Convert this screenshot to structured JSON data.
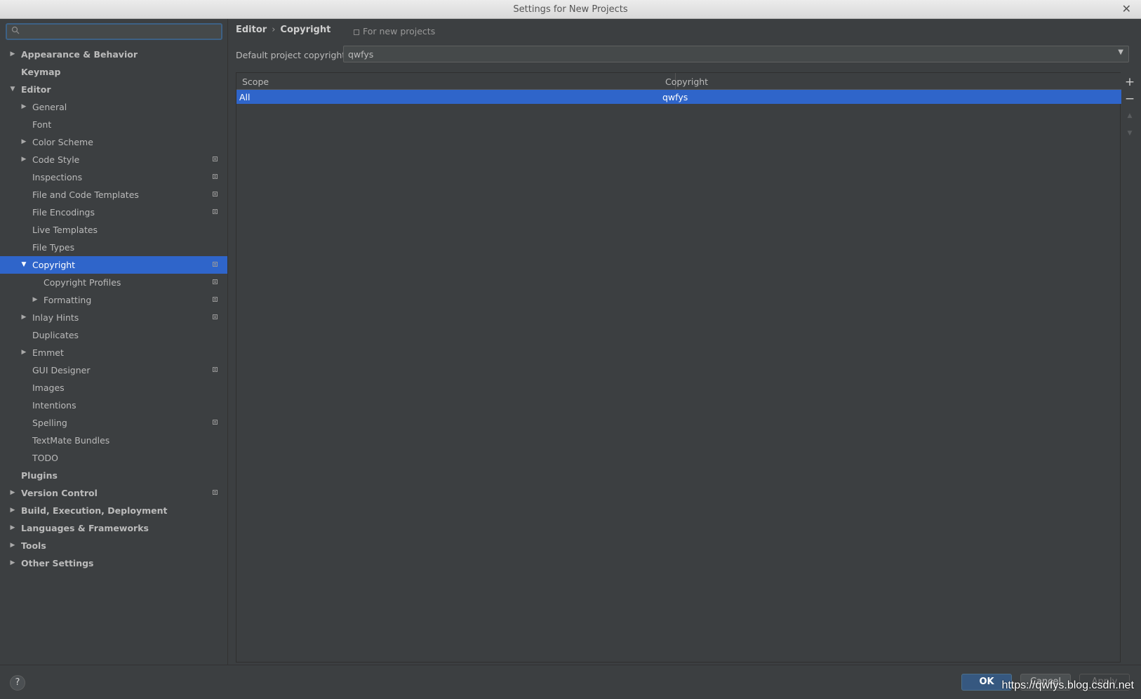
{
  "window": {
    "title": "Settings for New Projects",
    "close_glyph": "✕"
  },
  "sidebar": {
    "search": {
      "value": "",
      "placeholder": ""
    },
    "items": [
      {
        "label": "Appearance & Behavior",
        "level": 0,
        "expander": "collapsed",
        "bold": true,
        "project_icon": false,
        "selected": false
      },
      {
        "label": "Keymap",
        "level": 0,
        "expander": "none",
        "bold": true,
        "project_icon": false,
        "selected": false
      },
      {
        "label": "Editor",
        "level": 0,
        "expander": "expanded",
        "bold": true,
        "project_icon": false,
        "selected": false
      },
      {
        "label": "General",
        "level": 1,
        "expander": "collapsed",
        "bold": false,
        "project_icon": false,
        "selected": false
      },
      {
        "label": "Font",
        "level": 1,
        "expander": "none",
        "bold": false,
        "project_icon": false,
        "selected": false
      },
      {
        "label": "Color Scheme",
        "level": 1,
        "expander": "collapsed",
        "bold": false,
        "project_icon": false,
        "selected": false
      },
      {
        "label": "Code Style",
        "level": 1,
        "expander": "collapsed",
        "bold": false,
        "project_icon": true,
        "selected": false
      },
      {
        "label": "Inspections",
        "level": 1,
        "expander": "none",
        "bold": false,
        "project_icon": true,
        "selected": false
      },
      {
        "label": "File and Code Templates",
        "level": 1,
        "expander": "none",
        "bold": false,
        "project_icon": true,
        "selected": false
      },
      {
        "label": "File Encodings",
        "level": 1,
        "expander": "none",
        "bold": false,
        "project_icon": true,
        "selected": false
      },
      {
        "label": "Live Templates",
        "level": 1,
        "expander": "none",
        "bold": false,
        "project_icon": false,
        "selected": false
      },
      {
        "label": "File Types",
        "level": 1,
        "expander": "none",
        "bold": false,
        "project_icon": false,
        "selected": false
      },
      {
        "label": "Copyright",
        "level": 1,
        "expander": "expanded",
        "bold": false,
        "project_icon": true,
        "selected": true
      },
      {
        "label": "Copyright Profiles",
        "level": 2,
        "expander": "none",
        "bold": false,
        "project_icon": true,
        "selected": false
      },
      {
        "label": "Formatting",
        "level": 2,
        "expander": "collapsed",
        "bold": false,
        "project_icon": true,
        "selected": false
      },
      {
        "label": "Inlay Hints",
        "level": 1,
        "expander": "collapsed",
        "bold": false,
        "project_icon": true,
        "selected": false
      },
      {
        "label": "Duplicates",
        "level": 1,
        "expander": "none",
        "bold": false,
        "project_icon": false,
        "selected": false
      },
      {
        "label": "Emmet",
        "level": 1,
        "expander": "collapsed",
        "bold": false,
        "project_icon": false,
        "selected": false
      },
      {
        "label": "GUI Designer",
        "level": 1,
        "expander": "none",
        "bold": false,
        "project_icon": true,
        "selected": false
      },
      {
        "label": "Images",
        "level": 1,
        "expander": "none",
        "bold": false,
        "project_icon": false,
        "selected": false
      },
      {
        "label": "Intentions",
        "level": 1,
        "expander": "none",
        "bold": false,
        "project_icon": false,
        "selected": false
      },
      {
        "label": "Spelling",
        "level": 1,
        "expander": "none",
        "bold": false,
        "project_icon": true,
        "selected": false
      },
      {
        "label": "TextMate Bundles",
        "level": 1,
        "expander": "none",
        "bold": false,
        "project_icon": false,
        "selected": false
      },
      {
        "label": "TODO",
        "level": 1,
        "expander": "none",
        "bold": false,
        "project_icon": false,
        "selected": false
      },
      {
        "label": "Plugins",
        "level": 0,
        "expander": "none",
        "bold": true,
        "project_icon": false,
        "selected": false
      },
      {
        "label": "Version Control",
        "level": 0,
        "expander": "collapsed",
        "bold": true,
        "project_icon": true,
        "selected": false
      },
      {
        "label": "Build, Execution, Deployment",
        "level": 0,
        "expander": "collapsed",
        "bold": true,
        "project_icon": false,
        "selected": false
      },
      {
        "label": "Languages & Frameworks",
        "level": 0,
        "expander": "collapsed",
        "bold": true,
        "project_icon": false,
        "selected": false
      },
      {
        "label": "Tools",
        "level": 0,
        "expander": "collapsed",
        "bold": true,
        "project_icon": false,
        "selected": false
      },
      {
        "label": "Other Settings",
        "level": 0,
        "expander": "collapsed",
        "bold": true,
        "project_icon": false,
        "selected": false
      }
    ]
  },
  "main": {
    "breadcrumb": {
      "parent": "Editor",
      "separator": "›",
      "current": "Copyright"
    },
    "for_new_projects": "For new projects",
    "default_copyright": {
      "label": "Default project copyright:",
      "value": "qwfys"
    },
    "table": {
      "columns": [
        "Scope",
        "Copyright"
      ],
      "rows": [
        {
          "scope": "All",
          "copyright": "qwfys"
        }
      ]
    },
    "table_tools": {
      "add": "+",
      "remove": "−",
      "up": "▲",
      "down": "▼"
    }
  },
  "footer": {
    "help": "?",
    "ok": "OK",
    "cancel": "Cancel",
    "apply": "Apply",
    "watermark": "https://qwfys.blog.csdn.net"
  },
  "colors": {
    "background": "#3c3f41",
    "selection": "#2f65ca",
    "ok_button": "#365880"
  }
}
